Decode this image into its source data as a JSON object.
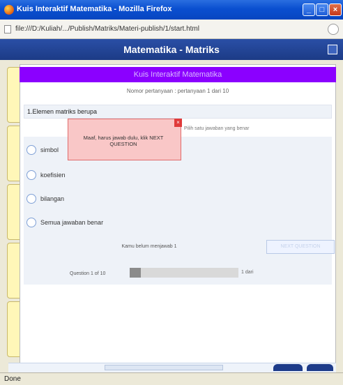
{
  "window": {
    "title": "Kuis Interaktif Matematika - Mozilla Firefox",
    "url": "file:///D:/Kuliah/.../Publish/Matriks/Materi-publish/1/start.html",
    "status": "Done"
  },
  "app": {
    "title": "Matematika - Matriks"
  },
  "quiz": {
    "banner": "Kuis Interaktif Matematika",
    "counter": "Nomor pertanyaan : pertanyaan 1 dari 10",
    "question": "1.Elemen matriks berupa",
    "hint": "Pilih satu jawaban yang benar",
    "answers": [
      {
        "label": "simbol"
      },
      {
        "label": "koefisien"
      },
      {
        "label": "bilangan"
      },
      {
        "label": "Semua jawaban benar"
      }
    ],
    "answered_msg": "Kamu belum menjawab 1",
    "next_label": "NEXT QUESTION",
    "progress_label": "Question 1 of 10",
    "progress_count": "1 dari",
    "progress_fraction": 0.1
  },
  "popup": {
    "text": "Maaf, harus jawab dulu, klik NEXT QUESTION"
  },
  "colors": {
    "banner": "#8b00ff",
    "header": "#1c3b86",
    "popup_bg": "#f9c7c7",
    "popup_border": "#e06b6b"
  }
}
